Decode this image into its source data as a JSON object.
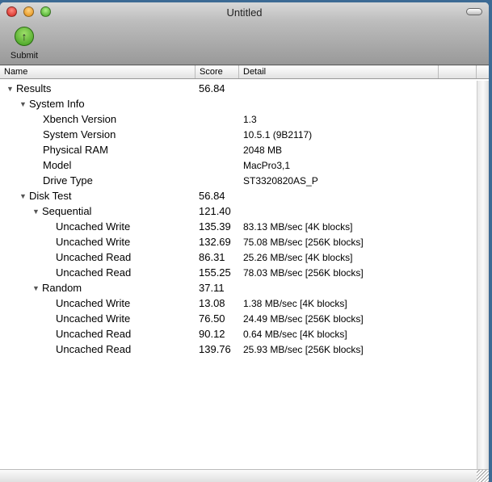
{
  "window": {
    "title": "Untitled"
  },
  "toolbar": {
    "submit_label": "Submit"
  },
  "columns": {
    "name": "Name",
    "score": "Score",
    "detail": "Detail"
  },
  "rows": [
    {
      "level": 0,
      "expander": true,
      "name": "Results",
      "score": "56.84",
      "detail": ""
    },
    {
      "level": 1,
      "expander": true,
      "name": "System Info",
      "score": "",
      "detail": ""
    },
    {
      "level": 2,
      "expander": false,
      "name": "Xbench Version",
      "score": "",
      "detail": "1.3"
    },
    {
      "level": 2,
      "expander": false,
      "name": "System Version",
      "score": "",
      "detail": "10.5.1 (9B2117)"
    },
    {
      "level": 2,
      "expander": false,
      "name": "Physical RAM",
      "score": "",
      "detail": "2048 MB"
    },
    {
      "level": 2,
      "expander": false,
      "name": "Model",
      "score": "",
      "detail": "MacPro3,1"
    },
    {
      "level": 2,
      "expander": false,
      "name": "Drive Type",
      "score": "",
      "detail": "ST3320820AS_P"
    },
    {
      "level": 1,
      "expander": true,
      "name": "Disk Test",
      "score": "56.84",
      "detail": ""
    },
    {
      "level": 2,
      "expander": true,
      "name": "Sequential",
      "score": "121.40",
      "detail": ""
    },
    {
      "level": 3,
      "expander": false,
      "name": "Uncached Write",
      "score": "135.39",
      "detail": "83.13 MB/sec [4K blocks]"
    },
    {
      "level": 3,
      "expander": false,
      "name": "Uncached Write",
      "score": "132.69",
      "detail": "75.08 MB/sec [256K blocks]"
    },
    {
      "level": 3,
      "expander": false,
      "name": "Uncached Read",
      "score": "86.31",
      "detail": "25.26 MB/sec [4K blocks]"
    },
    {
      "level": 3,
      "expander": false,
      "name": "Uncached Read",
      "score": "155.25",
      "detail": "78.03 MB/sec [256K blocks]"
    },
    {
      "level": 2,
      "expander": true,
      "name": "Random",
      "score": "37.11",
      "detail": ""
    },
    {
      "level": 3,
      "expander": false,
      "name": "Uncached Write",
      "score": "13.08",
      "detail": "1.38 MB/sec [4K blocks]"
    },
    {
      "level": 3,
      "expander": false,
      "name": "Uncached Write",
      "score": "76.50",
      "detail": "24.49 MB/sec [256K blocks]"
    },
    {
      "level": 3,
      "expander": false,
      "name": "Uncached Read",
      "score": "90.12",
      "detail": "0.64 MB/sec [4K blocks]"
    },
    {
      "level": 3,
      "expander": false,
      "name": "Uncached Read",
      "score": "139.76",
      "detail": "25.93 MB/sec [256K blocks]"
    }
  ]
}
